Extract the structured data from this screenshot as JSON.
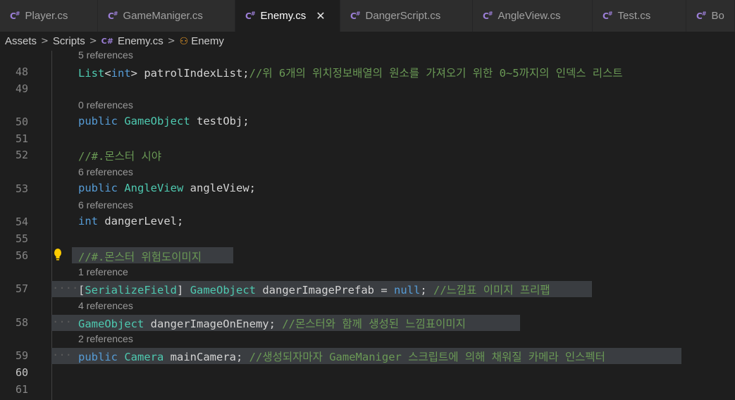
{
  "tabs": [
    {
      "label": "Player.cs",
      "active": false
    },
    {
      "label": "GameManiger.cs",
      "active": false
    },
    {
      "label": "Enemy.cs",
      "active": true
    },
    {
      "label": "DangerScript.cs",
      "active": false
    },
    {
      "label": "AngleView.cs",
      "active": false
    },
    {
      "label": "Test.cs",
      "active": false
    },
    {
      "label": "Bo",
      "active": false
    }
  ],
  "tab_close_glyph": "✕",
  "breadcrumb": {
    "folder1": "Assets",
    "folder2": "Scripts",
    "file": "Enemy.cs",
    "symbol": "Enemy"
  },
  "lines": {
    "lens_top": "5 references",
    "l48": {
      "num": "48",
      "code": "List<int> patrolIndexList;",
      "comment": "//위 6개의 위치정보배열의 원소를 가져오기 위한 0~5까지의 인덱스 리스트"
    },
    "l49": {
      "num": "49"
    },
    "lens50": "0 references",
    "l50": {
      "num": "50",
      "kw": "public",
      "type": "GameObject",
      "rest": " testObj;"
    },
    "l51": {
      "num": "51"
    },
    "l52": {
      "num": "52",
      "comment": "//#.몬스터 시야"
    },
    "lens53": "6 references",
    "l53": {
      "num": "53",
      "kw": "public",
      "type": "AngleView",
      "rest": " angleView;"
    },
    "lens54": "6 references",
    "l54": {
      "num": "54",
      "kw": "int",
      "rest": " dangerLevel;"
    },
    "l55": {
      "num": "55"
    },
    "l56": {
      "num": "56",
      "comment": "//#.몬스터 위험도이미지"
    },
    "lens57": "1 reference",
    "l57": {
      "num": "57",
      "attr_open": "[",
      "attr": "SerializeField",
      "attr_close": "]",
      "type": "GameObject",
      "rest": " dangerImagePrefab = ",
      "null_kw": "null",
      "semi": ";",
      "comment": " //느낌표 이미지 프리팹"
    },
    "lens58": "4 references",
    "l58": {
      "num": "58",
      "type": "GameObject",
      "rest": " dangerImageOnEnemy;",
      "comment": " //몬스터와 함께 생성된 느낌표이미지"
    },
    "lens59": "2 references",
    "l59": {
      "num": "59",
      "kw": "public",
      "type": "Camera",
      "rest": " mainCamera;",
      "comment": " //생성되자마자 GameManiger 스크립트에 의해 채워질 카메라 인스펙터"
    },
    "l60": {
      "num": "60"
    },
    "l61": {
      "num": "61"
    }
  },
  "colors": {
    "keyword": "#569cd6",
    "type": "#4ec9b0",
    "comment": "#6a9955",
    "selection": "#3a3d41"
  },
  "icons": {
    "tab_icon": "csharp-icon",
    "breadcrumb_class_icon": "class-icon",
    "lightbulb": "lightbulb-icon"
  }
}
